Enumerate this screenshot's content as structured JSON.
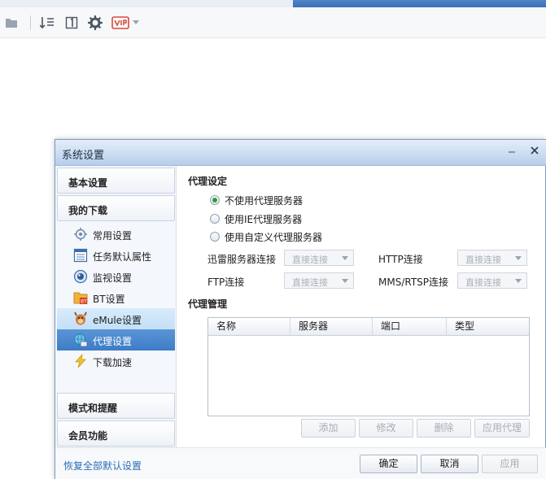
{
  "toolbar": {
    "icons": [
      "folder-icon",
      "sort-icon",
      "page-one-icon",
      "gear-icon",
      "vip-icon",
      "dropdown-arrow-icon"
    ]
  },
  "dialog": {
    "title": "系统设置",
    "minimize_label": "最小化",
    "close_label": "关闭"
  },
  "sidebar": {
    "basic_settings": "基本设置",
    "my_downloads": "我的下载",
    "items": [
      {
        "label": "常用设置",
        "icon": "gear-sun-icon"
      },
      {
        "label": "任务默认属性",
        "icon": "list-window-icon"
      },
      {
        "label": "监视设置",
        "icon": "eye-icon"
      },
      {
        "label": "BT设置",
        "icon": "bt-folder-icon"
      },
      {
        "label": "eMule设置",
        "icon": "emule-mule-icon"
      },
      {
        "label": "代理设置",
        "icon": "proxy-globe-icon"
      },
      {
        "label": "下载加速",
        "icon": "lightning-icon"
      }
    ],
    "mode_reminder": "模式和提醒",
    "member_features": "会员功能"
  },
  "content": {
    "proxy_setup_title": "代理设定",
    "radios": [
      {
        "label": "不使用代理服务器",
        "checked": true
      },
      {
        "label": "使用IE代理服务器",
        "checked": false
      },
      {
        "label": "使用自定义代理服务器",
        "checked": false
      }
    ],
    "connections": {
      "xunlei_label": "迅雷服务器连接",
      "xunlei_value": "直接连接",
      "http_label": "HTTP连接",
      "http_value": "直接连接",
      "ftp_label": "FTP连接",
      "ftp_value": "直接连接",
      "mms_label": "MMS/RTSP连接",
      "mms_value": "直接连接"
    },
    "proxy_manage_title": "代理管理",
    "table": {
      "columns": [
        "名称",
        "服务器",
        "端口",
        "类型"
      ],
      "rows": []
    },
    "buttons": {
      "add": "添加",
      "edit": "修改",
      "delete": "删除",
      "apply_proxy": "应用代理"
    }
  },
  "footer": {
    "restore_defaults": "恢复全部默认设置",
    "ok": "确定",
    "cancel": "取消",
    "apply": "应用"
  },
  "colors": {
    "accent": "#3d7cc6",
    "radio_checked": "#2f9d3a",
    "link": "#2a6cb8"
  }
}
